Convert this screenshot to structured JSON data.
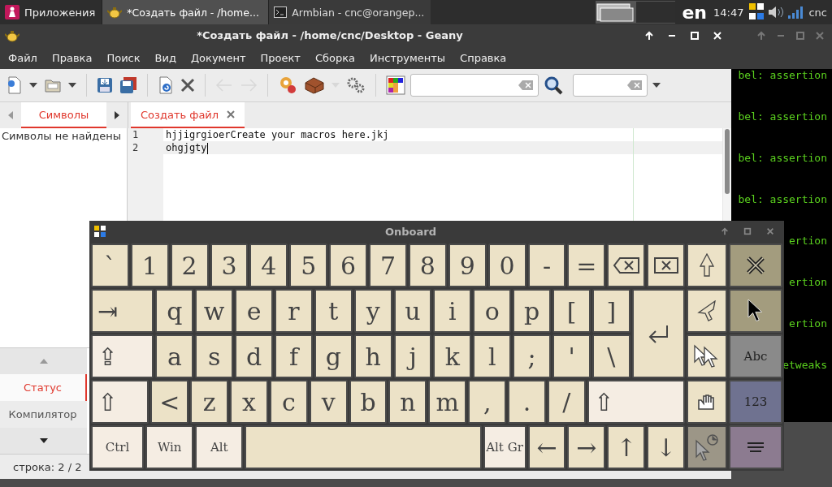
{
  "panel": {
    "apps_label": "Приложения",
    "tasks": [
      {
        "label": "*Создать файл - /home...",
        "selected": true,
        "kind": "editor"
      },
      {
        "label": "Armbian - cnc@orangep...",
        "selected": false,
        "kind": "terminal"
      }
    ],
    "layout": "en",
    "clock": "14:47",
    "user": "cnc"
  },
  "geany": {
    "title": "*Создать файл - /home/cnc/Desktop - Geany",
    "menu": [
      "Файл",
      "Правка",
      "Поиск",
      "Вид",
      "Документ",
      "Проект",
      "Сборка",
      "Инструменты",
      "Справка"
    ],
    "toolbar": [
      [
        {
          "kind": "new",
          "disabled": false
        },
        {
          "kind": "caret",
          "disabled": false
        },
        {
          "kind": "open",
          "disabled": false
        },
        {
          "kind": "caret",
          "disabled": false
        }
      ],
      [
        {
          "kind": "save",
          "disabled": false
        },
        {
          "kind": "save-all",
          "disabled": false
        }
      ],
      [
        {
          "kind": "reload",
          "disabled": false
        },
        {
          "kind": "close",
          "disabled": false
        }
      ],
      [
        {
          "kind": "back",
          "disabled": true
        },
        {
          "kind": "forward",
          "disabled": true
        }
      ],
      [
        {
          "kind": "compile",
          "disabled": false
        },
        {
          "kind": "build",
          "disabled": false
        },
        {
          "kind": "caret",
          "disabled": true
        },
        {
          "kind": "execute",
          "disabled": false
        }
      ],
      [
        {
          "kind": "color",
          "disabled": false
        },
        {
          "kind": "search-field",
          "disabled": false
        },
        {
          "kind": "search",
          "disabled": false
        },
        {
          "kind": "goto-field",
          "disabled": false
        },
        {
          "kind": "caret",
          "disabled": false
        }
      ]
    ],
    "sidebar_tabs": [
      {
        "label": "Символы",
        "selected": true
      }
    ],
    "sidebar_text": "Символы не найдены",
    "doc_tabs": [
      {
        "label": "Создать файл",
        "selected": true
      }
    ],
    "lines": [
      {
        "number": "1",
        "text": "hjjigrgioerCreate your macros here.jkj",
        "current": false
      },
      {
        "number": "2",
        "text": "ohgjgty",
        "current": true
      }
    ],
    "message_tabs": [
      {
        "label": "Статус",
        "selected": true
      },
      {
        "label": "Компилятор",
        "selected": false
      }
    ],
    "status": "строка: 2 / 2"
  },
  "terminal": {
    "lines": [
      "bel: assertion",
      "bel: assertion",
      "bel: assertion",
      "bel: assertion",
      "ertion",
      "ertion",
      "ertion",
      "etweaks"
    ]
  },
  "onboard": {
    "title": "Onboard",
    "keys": [
      {
        "kind": "key",
        "label": "`"
      },
      {
        "kind": "key",
        "label": "1"
      },
      {
        "kind": "key",
        "label": "2"
      },
      {
        "kind": "key",
        "label": "3"
      },
      {
        "kind": "key",
        "label": "4"
      },
      {
        "kind": "key",
        "label": "5"
      },
      {
        "kind": "key",
        "label": "6"
      },
      {
        "kind": "key",
        "label": "7"
      },
      {
        "kind": "key",
        "label": "8"
      },
      {
        "kind": "key",
        "label": "9"
      },
      {
        "kind": "key",
        "label": "0"
      },
      {
        "kind": "key",
        "label": "-"
      },
      {
        "kind": "key",
        "label": "="
      },
      {
        "kind": "backspace"
      },
      {
        "kind": "delete"
      },
      {
        "kind": "tab",
        "label": "⇥"
      },
      {
        "kind": "key",
        "label": "q"
      },
      {
        "kind": "key",
        "label": "w"
      },
      {
        "kind": "key",
        "label": "e"
      },
      {
        "kind": "key",
        "label": "r"
      },
      {
        "kind": "key",
        "label": "t"
      },
      {
        "kind": "key",
        "label": "y"
      },
      {
        "kind": "key",
        "label": "u"
      },
      {
        "kind": "key",
        "label": "i"
      },
      {
        "kind": "key",
        "label": "o"
      },
      {
        "kind": "key",
        "label": "p"
      },
      {
        "kind": "key",
        "label": "["
      },
      {
        "kind": "key",
        "label": "]"
      },
      {
        "kind": "enter"
      },
      {
        "kind": "caps",
        "label": "⇪"
      },
      {
        "kind": "key",
        "label": "a"
      },
      {
        "kind": "key",
        "label": "s"
      },
      {
        "kind": "key",
        "label": "d"
      },
      {
        "kind": "key",
        "label": "f"
      },
      {
        "kind": "key",
        "label": "g"
      },
      {
        "kind": "key",
        "label": "h"
      },
      {
        "kind": "key",
        "label": "j"
      },
      {
        "kind": "key",
        "label": "k"
      },
      {
        "kind": "key",
        "label": "l"
      },
      {
        "kind": "key",
        "label": ";"
      },
      {
        "kind": "key",
        "label": "'"
      },
      {
        "kind": "key",
        "label": "\\"
      },
      {
        "kind": "shift-left",
        "label": "⇧"
      },
      {
        "kind": "key",
        "label": "<"
      },
      {
        "kind": "key",
        "label": "z"
      },
      {
        "kind": "key",
        "label": "x"
      },
      {
        "kind": "key",
        "label": "c"
      },
      {
        "kind": "key",
        "label": "v"
      },
      {
        "kind": "key",
        "label": "b"
      },
      {
        "kind": "key",
        "label": "n"
      },
      {
        "kind": "key",
        "label": "m"
      },
      {
        "kind": "key",
        "label": ","
      },
      {
        "kind": "key",
        "label": "."
      },
      {
        "kind": "key",
        "label": "/"
      },
      {
        "kind": "shift-right",
        "label": "⇧"
      },
      {
        "kind": "ctrl",
        "label": "Ctrl"
      },
      {
        "kind": "win",
        "label": "Win"
      },
      {
        "kind": "alt",
        "label": "Alt"
      },
      {
        "kind": "space"
      },
      {
        "kind": "altgr",
        "label": "Alt Gr"
      },
      {
        "kind": "arrow",
        "label": "←"
      },
      {
        "kind": "arrow",
        "label": "→"
      },
      {
        "kind": "arrow",
        "label": "↑"
      },
      {
        "kind": "arrow",
        "label": "↓"
      }
    ],
    "side_keys": [
      {
        "kind": "pointer-up",
        "disabled": false
      },
      {
        "kind": "hide",
        "disabled": false
      },
      {
        "kind": "pointer-left",
        "disabled": false
      },
      {
        "kind": "pointer",
        "disabled": false
      },
      {
        "kind": "pointer-double",
        "disabled": false
      },
      {
        "kind": "layer",
        "label": "Abc",
        "disabled": false
      },
      {
        "kind": "hand",
        "disabled": false
      },
      {
        "kind": "layer-num",
        "label": "123",
        "disabled": false
      },
      {
        "kind": "pointer-clock",
        "disabled": true
      },
      {
        "kind": "menu",
        "disabled": false
      }
    ]
  }
}
